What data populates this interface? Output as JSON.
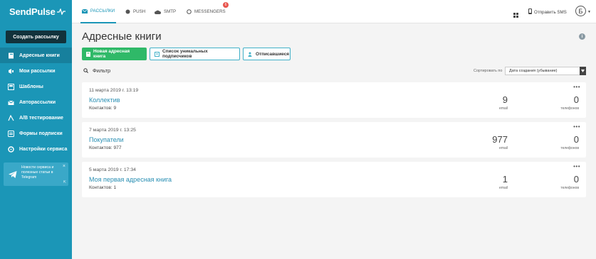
{
  "brand": {
    "name": "SendPulse"
  },
  "sidebar": {
    "create_button": "Создать рассылку",
    "items": [
      {
        "label": "Адресные книги",
        "icon": "address-book-icon"
      },
      {
        "label": "Мои рассылки",
        "icon": "megaphone-icon"
      },
      {
        "label": "Шаблоны",
        "icon": "templates-icon"
      },
      {
        "label": "Авторассылки",
        "icon": "automation-icon"
      },
      {
        "label": "A/B тестирование",
        "icon": "ab-test-icon"
      },
      {
        "label": "Формы подписки",
        "icon": "form-icon"
      },
      {
        "label": "Настройки сервиса",
        "icon": "settings-icon"
      }
    ],
    "telegram": {
      "text": "Новости сервиса и полезные статьи в Telegram",
      "close": "×",
      "external": "⇱"
    }
  },
  "topbar": {
    "tabs": [
      {
        "label": "Рассылки",
        "icon": "email-icon"
      },
      {
        "label": "Push",
        "icon": "push-icon"
      },
      {
        "label": "SMTP",
        "icon": "smtp-icon"
      },
      {
        "label": "Messengers",
        "icon": "messengers-icon"
      }
    ],
    "messengers_badge": "6",
    "send_sms": "Отправить SMS",
    "avatar_letter": "Б"
  },
  "main": {
    "title": "Адресные книги",
    "buttons": {
      "new_book": "Новая адресная книга",
      "unique_list": "Список уникальных подписчиков",
      "unsubscribed": "Отписавшиеся"
    },
    "filter_label": "Фильтр",
    "sort": {
      "label": "Сортировать по",
      "value": "Дата создания (убывание)"
    },
    "cards": [
      {
        "date": "11 марта 2019 г. 13:19",
        "name": "Коллектив",
        "contacts": "Контактов: 9",
        "email_count": "9",
        "email_label": "email",
        "phone_count": "0",
        "phone_label": "телефонов"
      },
      {
        "date": "7 марта 2019 г. 13:25",
        "name": "Покупатели",
        "contacts": "Контактов: 977",
        "email_count": "977",
        "email_label": "email",
        "phone_count": "0",
        "phone_label": "телефонов"
      },
      {
        "date": "5 марта 2019 г. 17:34",
        "name": "Моя первая адресная книга",
        "contacts": "Контактов: 1",
        "email_count": "1",
        "email_label": "email",
        "phone_count": "0",
        "phone_label": "телефонов"
      }
    ],
    "more_glyph": "•••"
  },
  "colors": {
    "sidebar": "#1b96b7",
    "accent": "#1b96b7",
    "primary_button": "#2fb968",
    "create_button": "#12323b",
    "badge": "#e8554e",
    "link": "#2a8fb3"
  }
}
